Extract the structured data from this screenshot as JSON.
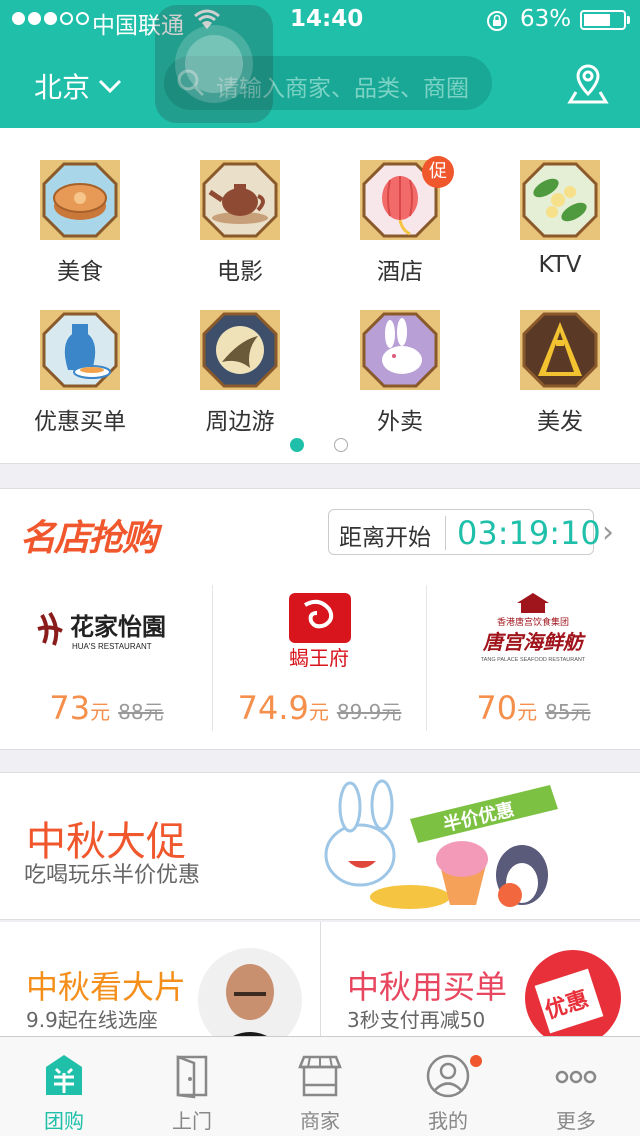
{
  "status_bar": {
    "carrier": "中国联通",
    "time": "14:40",
    "battery": "63%",
    "battery_level": 0.63,
    "signal_bars_filled": 3,
    "signal_bars_total": 5
  },
  "header": {
    "city": "北京",
    "search_placeholder": "请输入商家、品类、商圈"
  },
  "categories": [
    {
      "label": "美食",
      "icon": "mooncake-icon"
    },
    {
      "label": "电影",
      "icon": "teapot-icon"
    },
    {
      "label": "酒店",
      "icon": "lantern-icon",
      "badge": "促"
    },
    {
      "label": "KTV",
      "icon": "osmanthus-icon"
    },
    {
      "label": "优惠买单",
      "icon": "vase-icon"
    },
    {
      "label": "周边游",
      "icon": "change-fairy-icon"
    },
    {
      "label": "外卖",
      "icon": "rabbit-icon"
    },
    {
      "label": "美发",
      "icon": "firework-icon"
    }
  ],
  "pager": {
    "current": 1,
    "total": 2
  },
  "flash_sale": {
    "title": "名店抢购",
    "countdown_label": "距离开始",
    "countdown": "03:19:10",
    "deals": [
      {
        "name": "花家怡園",
        "sub": "HUA'S RESTAURANT",
        "price": "73",
        "unit": "元",
        "old_price": "88元"
      },
      {
        "name": "蝎王府",
        "price": "74.9",
        "unit": "元",
        "old_price": "89.9元"
      },
      {
        "name": "唐宫海鲜舫",
        "sub": "香港唐宫饮食集团",
        "sub2": "TANG PALACE SEAFOOD RESTAURANT",
        "price": "70",
        "unit": "元",
        "old_price": "85元"
      }
    ]
  },
  "promo": {
    "title": "中秋大促",
    "subtitle": "吃喝玩乐半价优惠",
    "ribbon": "半价优惠"
  },
  "half_promos": [
    {
      "title": "中秋看大片",
      "subtitle": "9.9起在线选座",
      "color": "#f58f1c"
    },
    {
      "title": "中秋用买单",
      "subtitle": "3秒支付再减50",
      "color": "#e8455e",
      "stamp": "优惠"
    }
  ],
  "tabs": [
    {
      "label": "团购",
      "icon": "groupbuy-icon",
      "active": true
    },
    {
      "label": "上门",
      "icon": "door-icon"
    },
    {
      "label": "商家",
      "icon": "store-icon"
    },
    {
      "label": "我的",
      "icon": "profile-icon",
      "dot": true
    },
    {
      "label": "更多",
      "icon": "more-icon"
    }
  ],
  "colors": {
    "brand": "#1fbfa9",
    "accent": "#f0572d",
    "price": "#f58f4c"
  }
}
